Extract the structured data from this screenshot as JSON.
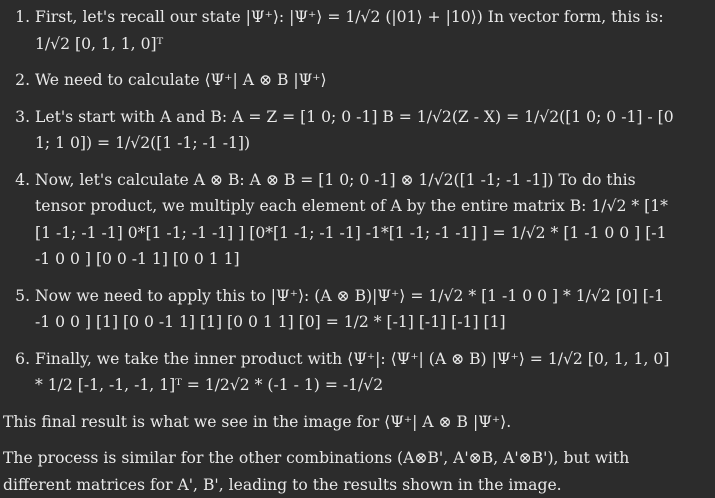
{
  "steps": [
    "First, let's recall our state |Ψ⁺⟩: |Ψ⁺⟩ = 1/√2 (|01⟩ + |10⟩) In vector form, this is: 1/√2 [0, 1, 1, 0]ᵀ",
    "We need to calculate ⟨Ψ⁺| A ⊗ B |Ψ⁺⟩",
    "Let's start with A and B: A = Z = [1 0; 0 -1] B = 1/√2(Z - X) = 1/√2([1 0; 0 -1] - [0 1; 1 0]) = 1/√2([1 -1; -1 -1])",
    "Now, let's calculate A ⊗ B: A ⊗ B = [1 0; 0 -1] ⊗ 1/√2([1 -1; -1 -1]) To do this tensor product, we multiply each element of A by the entire matrix B: 1/√2 * [1*[1 -1; -1 -1] 0*[1 -1; -1 -1] ] [0*[1 -1; -1 -1] -1*[1 -1; -1 -1] ] = 1/√2 * [1 -1 0 0 ] [-1 -1 0 0 ] [0 0 -1 1] [0 0 1 1]",
    "Now we need to apply this to |Ψ⁺⟩: (A ⊗ B)|Ψ⁺⟩ = 1/√2 * [1 -1 0 0 ] * 1/√2 [0] [-1 -1 0 0 ] [1] [0 0 -1 1] [1] [0 0 1 1] [0] = 1/2 * [-1] [-1] [-1] [1]",
    "Finally, we take the inner product with ⟨Ψ⁺|: ⟨Ψ⁺| (A ⊗ B) |Ψ⁺⟩ = 1/√2 [0, 1, 1, 0] * 1/2 [-1, -1, -1, 1]ᵀ = 1/2√2 * (-1 - 1) = -1/√2"
  ],
  "conclusion": "This final result is what we see in the image for ⟨Ψ⁺| A ⊗ B |Ψ⁺⟩.",
  "closing": "The process is similar for the other combinations (A⊗B', A'⊗B, A'⊗B'), but with different matrices for A', B', leading to the results shown in the image.",
  "colors": {
    "background": "#2c2c2c",
    "text": "#e9e9e9"
  }
}
